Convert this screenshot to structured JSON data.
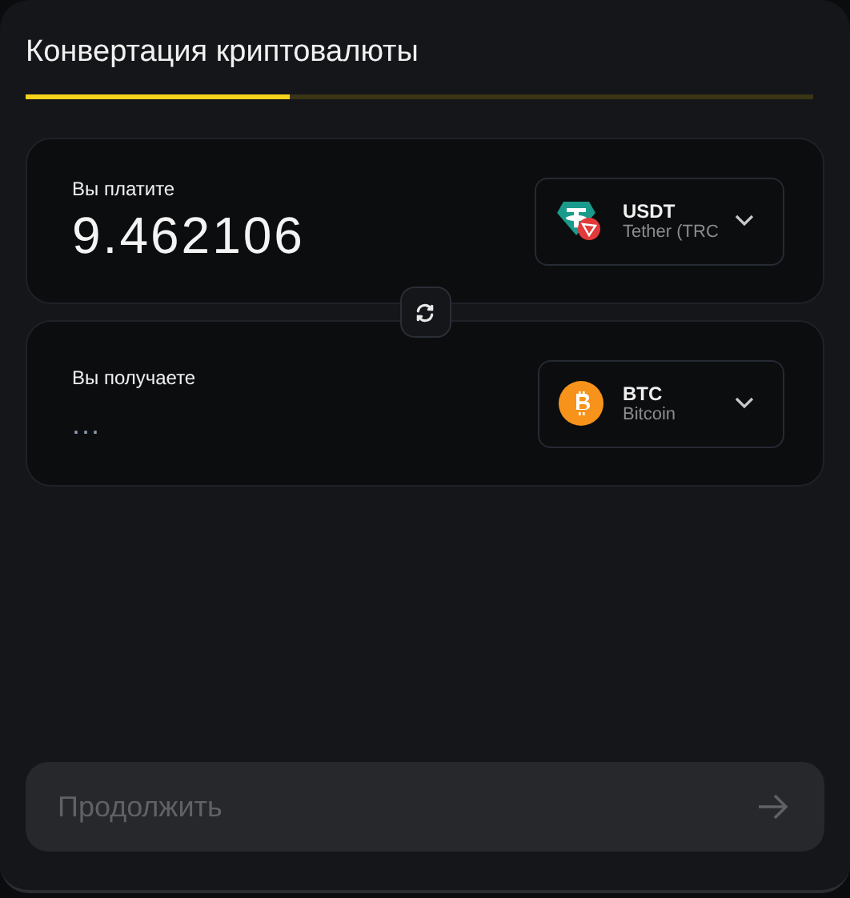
{
  "title": "Конвертация криптовалюты",
  "progress": {
    "level": 0.335
  },
  "cards": [
    {
      "label": "Вы платите",
      "amount": "9.462106",
      "kind": "value",
      "token": {
        "symbol": "USDT",
        "name": "Tether (TRC",
        "kind": "tether"
      }
    },
    {
      "label": "Вы получаете",
      "amount": "...",
      "kind": "pending",
      "token": {
        "symbol": "BTC",
        "name": "Bitcoin",
        "kind": "bitcoin"
      }
    }
  ],
  "continue_button": {
    "label": "Продолжить",
    "disabled": true
  }
}
